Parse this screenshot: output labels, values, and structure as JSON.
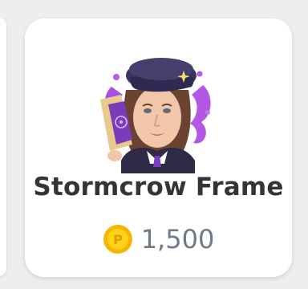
{
  "item": {
    "name": "Stormcrow Frame",
    "price": "1,500",
    "currency_icon": "coin-icon",
    "currency_glyph": "P",
    "art_icon": "avatar-frame-art"
  },
  "colors": {
    "coin_outer": "#f7b500",
    "coin_inner": "#ffd21a",
    "frame_purple": "#9b30d9",
    "hat": "#3a3460",
    "price_text": "#6e7a86",
    "title_text": "#333436"
  }
}
